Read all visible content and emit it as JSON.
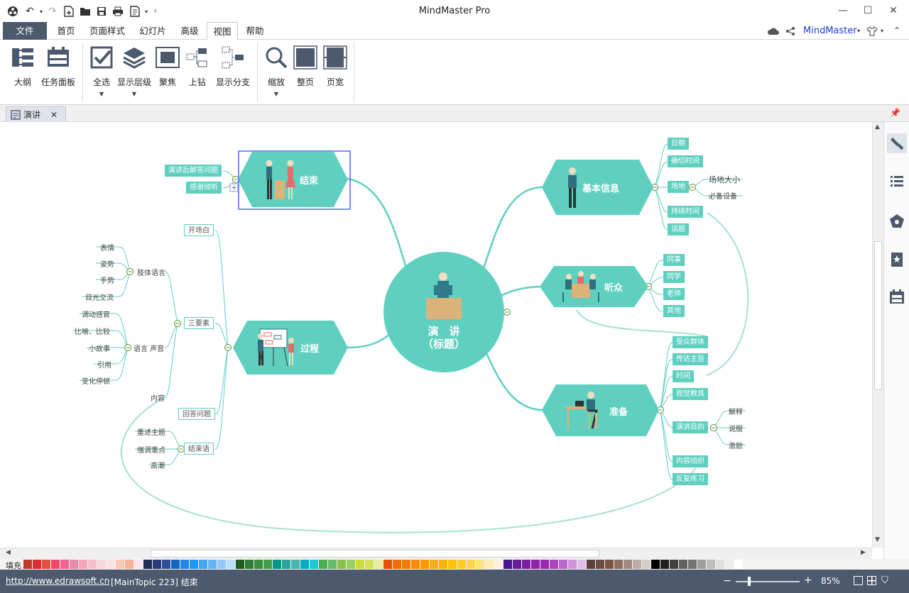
{
  "window": {
    "title": "MindMaster Pro"
  },
  "menu": {
    "tabs": [
      "文件",
      "首页",
      "页面样式",
      "幻灯片",
      "高级",
      "视图",
      "帮助"
    ],
    "active": "视图",
    "account": "MindMaster"
  },
  "ribbon": {
    "buttons": [
      "大纲",
      "任务面板",
      "全选",
      "显示层级",
      "聚焦",
      "上钻",
      "显示分支",
      "缩放",
      "整页",
      "页宽"
    ]
  },
  "doc_tab": {
    "label": "演讲"
  },
  "mindmap": {
    "center": {
      "line1": "演　讲",
      "line2": "（标题）"
    },
    "topics": {
      "end": "结束",
      "process": "过程",
      "basic_info": "基本信息",
      "audience": "听众",
      "prepare": "准备"
    },
    "end_children": [
      "演讲后解答问题",
      "感谢倾听"
    ],
    "basic_children": [
      "日期",
      "确切时间",
      "场地",
      "持续时间",
      "话题"
    ],
    "venue_children": [
      "场地大小",
      "必备设备"
    ],
    "audience_children": [
      "同事",
      "同学",
      "老师",
      "其他"
    ],
    "prepare_children": [
      "受众群体",
      "传达主旨",
      "时间",
      "视觉教具",
      "演讲目的",
      "内容组织",
      "反复练习"
    ],
    "purpose_children": [
      "解释",
      "说服",
      "激励"
    ],
    "process_children": [
      "开场白",
      "三要素",
      "回答问题",
      "结束语"
    ],
    "three_children": [
      "肢体语言",
      "语言  声音",
      "内容"
    ],
    "body_children": [
      "表情",
      "姿势",
      "手势",
      "目光交流"
    ],
    "voice_children": [
      "调动感官",
      "比喻、比较",
      "小故事",
      "引用",
      "变化停顿"
    ],
    "closing_children": [
      "重述主题",
      "强调重点",
      "高潮"
    ]
  },
  "palette": {
    "label": "填充"
  },
  "status": {
    "url": "http://www.edrawsoft.cn",
    "info": "[MainTopic 223]  结束",
    "zoom": "85%"
  },
  "colors": {
    "accent": "#5fd0c0",
    "chrome": "#4d5a6e",
    "selection": "#4a6cf7"
  }
}
